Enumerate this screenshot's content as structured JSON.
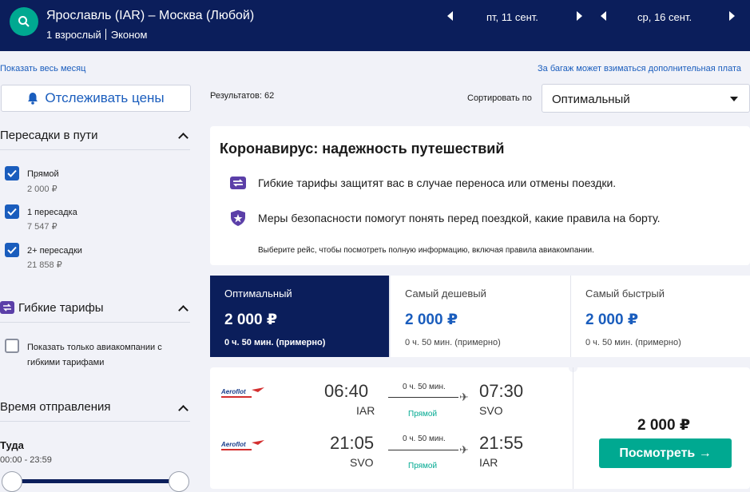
{
  "header": {
    "route": "Ярославль (IAR) – Москва (Любой)",
    "passengers": "1 взрослый",
    "cabin": "Эконом",
    "depart_date": "пт, 11 сент.",
    "return_date": "ср, 16 сент."
  },
  "links": {
    "show_month": "Показать весь месяц",
    "baggage_note": "За багаж может взиматься дополнительная плата"
  },
  "sidebar": {
    "track_prices": "Отслеживать цены",
    "stops": {
      "title": "Пересадки в пути",
      "options": [
        {
          "label": "Прямой",
          "price": "2 000 ₽",
          "checked": true
        },
        {
          "label": "1 пересадка",
          "price": "7 547 ₽",
          "checked": true
        },
        {
          "label": "2+ пересадки",
          "price": "21 858 ₽",
          "checked": true
        }
      ]
    },
    "flex": {
      "title": "Гибкие тарифы",
      "option_line1": "Показать только авиакомпании с",
      "option_line2": "гибкими тарифами",
      "checked": false
    },
    "departure_time": {
      "title": "Время отправления",
      "direction": "Туда",
      "range": "00:00 - 23:59"
    }
  },
  "results": {
    "count_label": "Результатов: 62",
    "sort_label": "Сортировать по",
    "sort_value": "Оптимальный"
  },
  "corona": {
    "title": "Коронавирус: надежность путешествий",
    "line1": "Гибкие тарифы защитят вас в случае переноса или отмены поездки.",
    "line2": "Меры безопасности помогут понять перед поездкой, какие правила на борту.",
    "note": "Выберите рейс, чтобы посмотреть полную информацию, включая правила авиакомпании."
  },
  "sort_tabs": [
    {
      "label": "Оптимальный",
      "price": "2 000 ₽",
      "duration": "0 ч. 50 мин. (примерно)",
      "active": true
    },
    {
      "label": "Самый дешевый",
      "price": "2 000 ₽",
      "duration": "0 ч. 50 мин. (примерно)",
      "active": false
    },
    {
      "label": "Самый быстрый",
      "price": "2 000 ₽",
      "duration": "0 ч. 50 мин. (примерно)",
      "active": false
    }
  ],
  "flight": {
    "segments": [
      {
        "airline": "Aeroflot",
        "dep_time": "06:40",
        "dep_code": "IAR",
        "arr_time": "07:30",
        "arr_code": "SVO",
        "duration": "0 ч. 50 мин.",
        "stops": "Прямой"
      },
      {
        "airline": "Aeroflot",
        "dep_time": "21:05",
        "dep_code": "SVO",
        "arr_time": "21:55",
        "arr_code": "IAR",
        "duration": "0 ч. 50 мин.",
        "stops": "Прямой"
      }
    ],
    "price": "2 000 ₽",
    "view_button": "Посмотреть →"
  },
  "colors": {
    "navy": "#0b1e5b",
    "accent_blue": "#1a5dbd",
    "teal": "#00a991",
    "page_bg": "#f1f2f8"
  }
}
